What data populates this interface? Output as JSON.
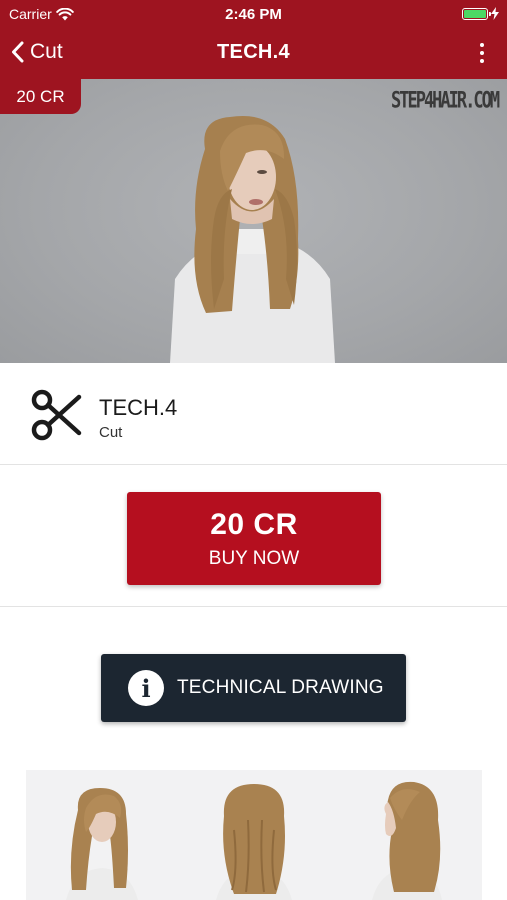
{
  "status_bar": {
    "carrier": "Carrier",
    "time": "2:46 PM",
    "battery_level": 1.0,
    "battery_color": "#4cd964"
  },
  "nav": {
    "back_label": "Cut",
    "title": "TECH.4",
    "back_icon": "chevron-left-icon",
    "more_icon": "more-vertical-icon"
  },
  "hero": {
    "price_badge": "20 CR",
    "logo": "STEP4HAIR.COM"
  },
  "product": {
    "icon": "scissors-icon",
    "title": "TECH.4",
    "category": "Cut"
  },
  "buy": {
    "price": "20 CR",
    "label": "BUY NOW"
  },
  "technical_drawing": {
    "icon": "info-icon",
    "label": "TECHNICAL DRAWING"
  },
  "gallery": {
    "views": [
      "front",
      "back",
      "side"
    ]
  },
  "colors": {
    "brand_red": "#9e1420",
    "buy_red": "#b50f1f",
    "dark_button": "#1c2631"
  }
}
